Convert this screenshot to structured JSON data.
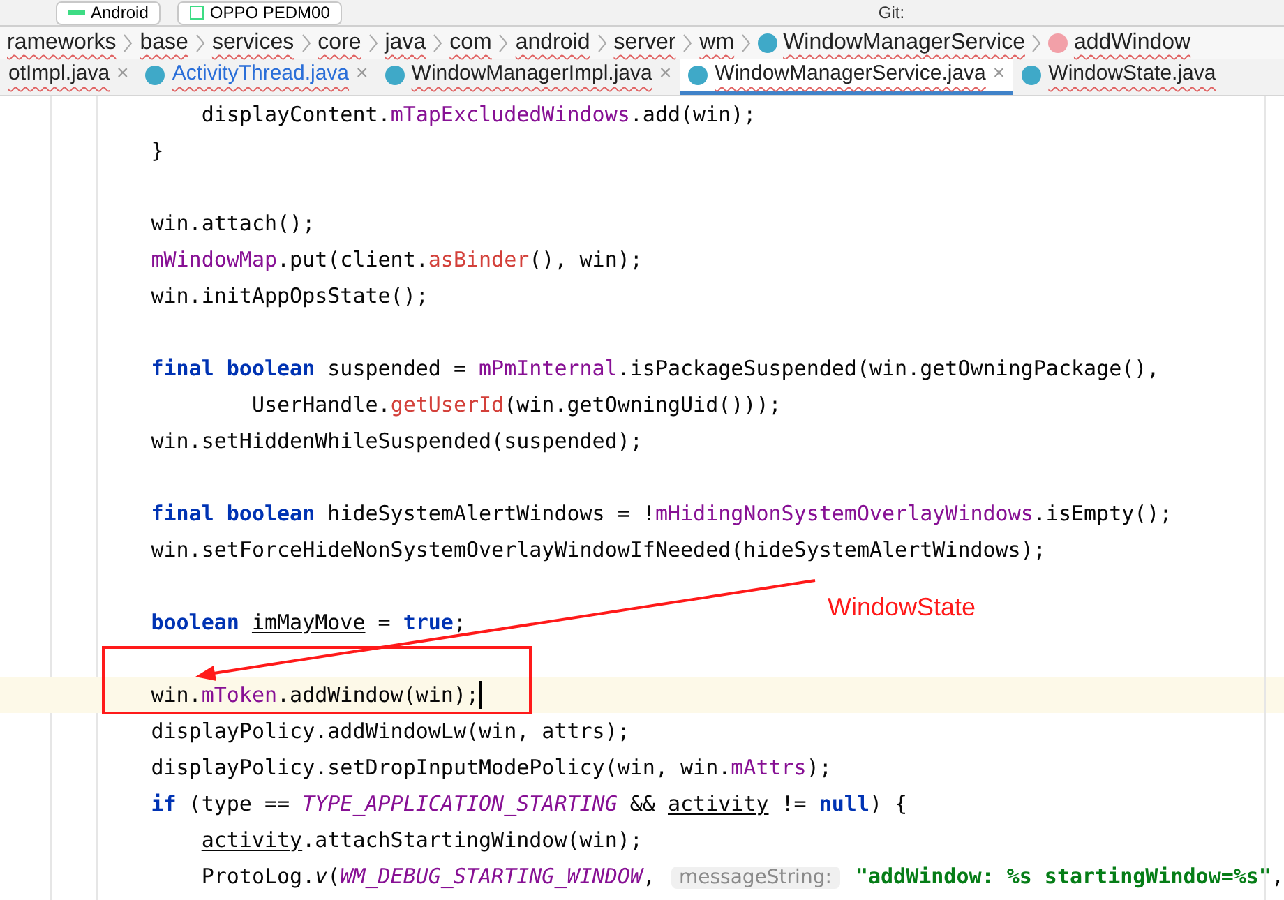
{
  "toolbar": {
    "configuration": "Android",
    "device": "OPPO PEDM00",
    "vcs_label": "Git:"
  },
  "breadcrumbs": [
    {
      "label": "rameworks",
      "kind": "folder"
    },
    {
      "label": "base",
      "kind": "folder"
    },
    {
      "label": "services",
      "kind": "folder"
    },
    {
      "label": "core",
      "kind": "folder"
    },
    {
      "label": "java",
      "kind": "folder"
    },
    {
      "label": "com",
      "kind": "folder"
    },
    {
      "label": "android",
      "kind": "folder"
    },
    {
      "label": "server",
      "kind": "folder"
    },
    {
      "label": "wm",
      "kind": "folder"
    },
    {
      "label": "WindowManagerService",
      "kind": "class"
    },
    {
      "label": "addWindow",
      "kind": "method"
    }
  ],
  "tabs": [
    {
      "label": "otImpl.java",
      "kind": "file",
      "modified": false,
      "close": "×",
      "selected": false
    },
    {
      "label": "ActivityThread.java",
      "kind": "class",
      "modified": true,
      "close": "×",
      "selected": false
    },
    {
      "label": "WindowManagerImpl.java",
      "kind": "class",
      "modified": false,
      "close": "×",
      "selected": false
    },
    {
      "label": "WindowManagerService.java",
      "kind": "class",
      "modified": false,
      "close": "×",
      "selected": true
    },
    {
      "label": "WindowState.java",
      "kind": "class",
      "modified": false,
      "selected": false
    }
  ],
  "code_lines": [
    {
      "kind": "code",
      "current": false,
      "tokens": [
        {
          "text": "    displayContent.",
          "kind": "plain"
        },
        {
          "text": "mTapExcludedWindows",
          "kind": "field"
        },
        {
          "text": ".add(win);",
          "kind": "plain"
        }
      ]
    },
    {
      "kind": "code",
      "current": false,
      "tokens": [
        {
          "text": "}",
          "kind": "plain"
        }
      ]
    },
    {
      "kind": "blank"
    },
    {
      "kind": "code",
      "current": false,
      "tokens": [
        {
          "text": "win.attach();",
          "kind": "plain"
        }
      ]
    },
    {
      "kind": "code",
      "current": false,
      "tokens": [
        {
          "text": "mWindowMap",
          "kind": "field"
        },
        {
          "text": ".put(client.",
          "kind": "plain"
        },
        {
          "text": "asBinder",
          "kind": "call"
        },
        {
          "text": "(), win);",
          "kind": "plain"
        }
      ]
    },
    {
      "kind": "code",
      "current": false,
      "tokens": [
        {
          "text": "win.initAppOpsState();",
          "kind": "plain"
        }
      ]
    },
    {
      "kind": "blank"
    },
    {
      "kind": "code",
      "current": false,
      "tokens": [
        {
          "text": "final boolean",
          "kind": "keyword"
        },
        {
          "text": " suspended = ",
          "kind": "plain"
        },
        {
          "text": "mPmInternal",
          "kind": "field"
        },
        {
          "text": ".isPackageSuspended(win.getOwningPackage(),",
          "kind": "plain"
        }
      ]
    },
    {
      "kind": "code",
      "current": false,
      "tokens": [
        {
          "text": "        UserHandle.",
          "kind": "plain"
        },
        {
          "text": "getUserId",
          "kind": "call"
        },
        {
          "text": "(win.getOwningUid()));",
          "kind": "plain"
        }
      ]
    },
    {
      "kind": "code",
      "current": false,
      "tokens": [
        {
          "text": "win.setHiddenWhileSuspended(suspended);",
          "kind": "plain"
        }
      ]
    },
    {
      "kind": "blank"
    },
    {
      "kind": "code",
      "current": false,
      "tokens": [
        {
          "text": "final boolean",
          "kind": "keyword"
        },
        {
          "text": " hideSystemAlertWindows = !",
          "kind": "plain"
        },
        {
          "text": "mHidingNonSystemOverlayWindows",
          "kind": "field"
        },
        {
          "text": ".isEmpty();",
          "kind": "plain"
        }
      ]
    },
    {
      "kind": "code",
      "current": false,
      "tokens": [
        {
          "text": "win.setForceHideNonSystemOverlayWindowIfNeeded(hideSystemAlertWindows);",
          "kind": "plain"
        }
      ]
    },
    {
      "kind": "blank"
    },
    {
      "kind": "code",
      "current": false,
      "tokens": [
        {
          "text": "boolean",
          "kind": "keyword"
        },
        {
          "text": " imMayMove",
          "kind": "reassigned"
        },
        {
          "text": " = ",
          "kind": "plain"
        },
        {
          "text": "true",
          "kind": "keyword"
        },
        {
          "text": ";",
          "kind": "plain"
        }
      ]
    },
    {
      "kind": "blank"
    },
    {
      "kind": "code",
      "current": true,
      "tokens": [
        {
          "text": "win.",
          "kind": "plain"
        },
        {
          "text": "mToken",
          "kind": "field"
        },
        {
          "text": ".addWindow(win);",
          "kind": "plain"
        }
      ]
    },
    {
      "kind": "code",
      "current": false,
      "tokens": [
        {
          "text": "displayPolicy.addWindowLw(win, attrs);",
          "kind": "plain"
        }
      ]
    },
    {
      "kind": "code",
      "current": false,
      "tokens": [
        {
          "text": "displayPolicy.setDropInputModePolicy(win, win.",
          "kind": "plain"
        },
        {
          "text": "mAttrs",
          "kind": "field"
        },
        {
          "text": ");",
          "kind": "plain"
        }
      ]
    },
    {
      "kind": "code",
      "current": false,
      "tokens": [
        {
          "text": "if",
          "kind": "keyword"
        },
        {
          "text": " (type == ",
          "kind": "plain"
        },
        {
          "text": "TYPE_APPLICATION_STARTING",
          "kind": "constant"
        },
        {
          "text": " && ",
          "kind": "plain"
        },
        {
          "text": "activity",
          "kind": "reassigned"
        },
        {
          "text": " != ",
          "kind": "plain"
        },
        {
          "text": "null",
          "kind": "keyword"
        },
        {
          "text": ") {",
          "kind": "plain"
        }
      ]
    },
    {
      "kind": "code",
      "current": false,
      "tokens": [
        {
          "text": "    activity",
          "kind": "reassigned"
        },
        {
          "text": ".attachStartingWindow(win);",
          "kind": "plain"
        }
      ]
    },
    {
      "kind": "code",
      "current": false,
      "tokens": [
        {
          "text": "    ProtoLog.",
          "kind": "plain"
        },
        {
          "text": "v",
          "kind": "staticcall"
        },
        {
          "text": "(",
          "kind": "plain"
        },
        {
          "text": "WM_DEBUG_STARTING_WINDOW",
          "kind": "constant"
        },
        {
          "text": ", ",
          "kind": "plain"
        },
        {
          "text": "messageString:",
          "kind": "hint"
        },
        {
          "text": " \"addWindow: %s startingWindow=%s\"",
          "kind": "string"
        },
        {
          "text": ",",
          "kind": "plain"
        }
      ]
    }
  ],
  "annotation": {
    "label": "WindowState"
  }
}
